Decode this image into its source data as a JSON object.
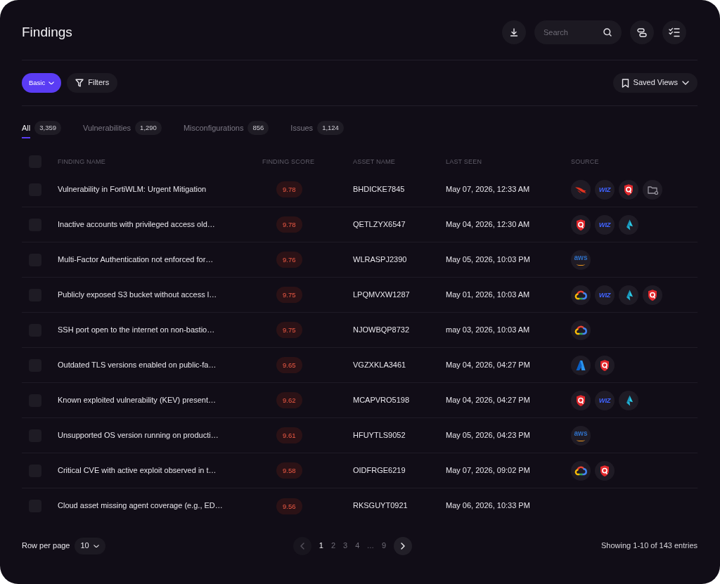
{
  "header": {
    "title": "Findings",
    "search": {
      "placeholder": "Search"
    }
  },
  "toolbar": {
    "view_button": "Basic",
    "filters_button": "Filters",
    "saved_views_button": "Saved Views"
  },
  "tabs": [
    {
      "label": "All",
      "count": "3,359",
      "selected": true
    },
    {
      "label": "Vulnerabilities",
      "count": "1,290",
      "selected": false
    },
    {
      "label": "Misconfigurations",
      "count": "856",
      "selected": false
    },
    {
      "label": "Issues",
      "count": "1,124",
      "selected": false
    }
  ],
  "table": {
    "select_all": {
      "checked": false
    },
    "columns": [
      "FINDING NAME",
      "FINDING SCORE",
      "ASSET NAME",
      "LAST SEEN",
      "SOURCE"
    ],
    "rows": [
      {
        "checked": false,
        "name": "Vulnerability in FortiWLM: Urgent Mitigation",
        "score": "9.78",
        "asset": "BHDICKE7845",
        "last_seen": "May 07, 2026, 12:33 AM",
        "sources": [
          {
            "kind": "bird"
          },
          {
            "kind": "wordmark",
            "text": "WIZ"
          },
          {
            "kind": "shield"
          },
          {
            "kind": "folder"
          }
        ]
      },
      {
        "checked": false,
        "name": "Inactive accounts with privileged access old…",
        "score": "9.78",
        "asset": "QETLZYX6547",
        "last_seen": "May 04, 2026, 12:30 AM",
        "sources": [
          {
            "kind": "shield"
          },
          {
            "kind": "wordmark",
            "text": "WIZ"
          },
          {
            "kind": "kite"
          }
        ]
      },
      {
        "checked": false,
        "name": "Multi-Factor Authentication not enforced for…",
        "score": "9.76",
        "asset": "WLRASPJ2390",
        "last_seen": "May 05, 2026, 10:03 PM",
        "sources": [
          {
            "kind": "smile",
            "text": "aws"
          }
        ]
      },
      {
        "checked": false,
        "name": "Publicly exposed S3 bucket without access l…",
        "score": "9.75",
        "asset": "LPQMVXW1287",
        "last_seen": "May 01, 2026, 10:03 AM",
        "sources": [
          {
            "kind": "cloud"
          },
          {
            "kind": "wordmark",
            "text": "WIZ"
          },
          {
            "kind": "kite"
          },
          {
            "kind": "shield"
          }
        ]
      },
      {
        "checked": false,
        "name": "SSH port open to the internet on non-bastio…",
        "score": "9.75",
        "asset": "NJOWBQP8732",
        "last_seen": "may 03, 2026, 10:03 AM",
        "sources": [
          {
            "kind": "cloud"
          }
        ]
      },
      {
        "checked": false,
        "name": "Outdated TLS versions enabled on public-fa…",
        "score": "9.65",
        "asset": "VGZXKLA3461",
        "last_seen": "May 04, 2026, 04:27 PM",
        "sources": [
          {
            "kind": "peak"
          },
          {
            "kind": "shield"
          }
        ]
      },
      {
        "checked": false,
        "name": "Known exploited vulnerability (KEV) present…",
        "score": "9.62",
        "asset": "MCAPVRO5198",
        "last_seen": "May 04, 2026, 04:27 PM",
        "sources": [
          {
            "kind": "shield"
          },
          {
            "kind": "wordmark",
            "text": "WIZ"
          },
          {
            "kind": "kite"
          }
        ]
      },
      {
        "checked": false,
        "name": "Unsupported OS version running on producti…",
        "score": "9.61",
        "asset": "HFUYTLS9052",
        "last_seen": "May 05, 2026, 04:23 PM",
        "sources": [
          {
            "kind": "smile",
            "text": "aws"
          }
        ]
      },
      {
        "checked": false,
        "name": "Critical CVE with active exploit observed in t…",
        "score": "9.58",
        "asset": "OIDFRGE6219",
        "last_seen": "May 07, 2026, 09:02 PM",
        "sources": [
          {
            "kind": "cloud"
          },
          {
            "kind": "shield"
          }
        ]
      },
      {
        "checked": false,
        "name": "Cloud asset missing agent coverage (e.g., ED…",
        "score": "9.56",
        "asset": "RKSGUYT0921",
        "last_seen": "May 06, 2026, 10:33 PM"
      }
    ]
  },
  "footer": {
    "rows_per_page_label": "Row per page",
    "rows_per_page": "10",
    "pagination": {
      "previous": {
        "disabled": true
      },
      "next": {
        "disabled": false
      },
      "pages": [
        {
          "kind": "page",
          "label": "1",
          "selected": true
        },
        {
          "kind": "page",
          "label": "2",
          "selected": false
        },
        {
          "kind": "page",
          "label": "3",
          "selected": false
        },
        {
          "kind": "page",
          "label": "4",
          "selected": false
        },
        {
          "kind": "ellipsis",
          "label": "...",
          "selected": false
        },
        {
          "kind": "page",
          "label": "9",
          "selected": false
        }
      ]
    },
    "summary": "Showing 1-10 of 143 entries"
  }
}
